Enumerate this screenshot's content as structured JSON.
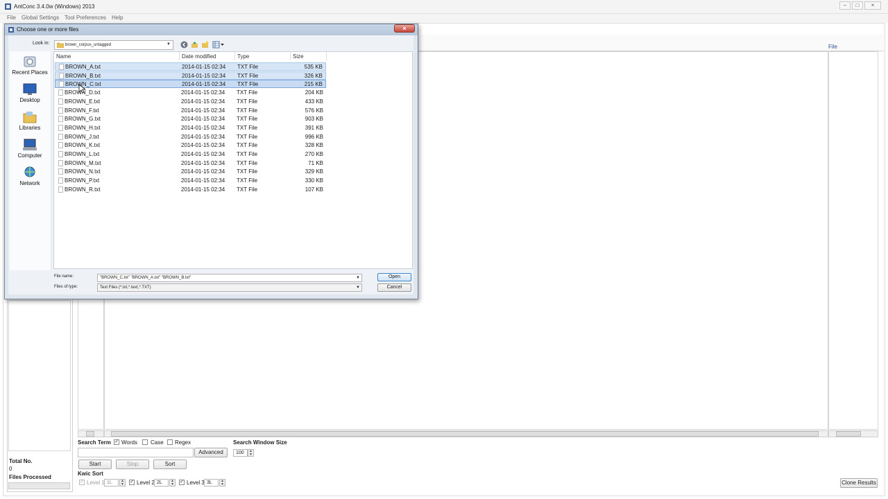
{
  "app": {
    "title": "AntConc 3.4.0w (Windows) 2013",
    "menu": [
      "File",
      "Global Settings",
      "Tool Preferences",
      "Help"
    ],
    "window_buttons": [
      "–",
      "□",
      "×"
    ]
  },
  "main": {
    "file_column_header": "File",
    "search": {
      "search_term_label": "Search Term",
      "words_label": "Words",
      "words_checked": true,
      "case_label": "Case",
      "case_checked": false,
      "regex_label": "Regex",
      "regex_checked": false,
      "advanced_label": "Advanced",
      "window_size_label": "Search Window Size",
      "window_size_value": "100"
    },
    "buttons": {
      "start": "Start",
      "stop": "Stop",
      "sort": "Sort"
    },
    "kwic": {
      "title": "Kwic Sort",
      "levels": [
        {
          "label": "Level 1",
          "value": "1L",
          "checked": false,
          "enabled": false
        },
        {
          "label": "Level 2",
          "value": "2L",
          "checked": true,
          "enabled": true
        },
        {
          "label": "Level 3",
          "value": "3L",
          "checked": true,
          "enabled": true
        }
      ]
    },
    "left_panel": {
      "total_label": "Total No.",
      "total_value": "0",
      "files_processed_label": "Files Processed"
    },
    "clone_results": "Clone Results"
  },
  "dialog": {
    "title": "Choose one or more files",
    "look_in_label": "Look in:",
    "look_in_value": "brown_corpus_untagged",
    "places": [
      "Recent Places",
      "Desktop",
      "Libraries",
      "Computer",
      "Network"
    ],
    "columns": [
      "Name",
      "Date modified",
      "Type",
      "Size"
    ],
    "files": [
      {
        "name": "BROWN_A.txt",
        "date": "2014-01-15 02:34",
        "type": "TXT File",
        "size": "535 KB",
        "selected": true
      },
      {
        "name": "BROWN_B.txt",
        "date": "2014-01-15 02:34",
        "type": "TXT File",
        "size": "326 KB",
        "selected": true
      },
      {
        "name": "BROWN_C.txt",
        "date": "2014-01-15 02:34",
        "type": "TXT File",
        "size": "215 KB",
        "selected": true,
        "focused": true
      },
      {
        "name": "BROWN_D.txt",
        "date": "2014-01-15 02:34",
        "type": "TXT File",
        "size": "204 KB"
      },
      {
        "name": "BROWN_E.txt",
        "date": "2014-01-15 02:34",
        "type": "TXT File",
        "size": "433 KB"
      },
      {
        "name": "BROWN_F.txt",
        "date": "2014-01-15 02:34",
        "type": "TXT File",
        "size": "576 KB"
      },
      {
        "name": "BROWN_G.txt",
        "date": "2014-01-15 02:34",
        "type": "TXT File",
        "size": "903 KB"
      },
      {
        "name": "BROWN_H.txt",
        "date": "2014-01-15 02:34",
        "type": "TXT File",
        "size": "391 KB"
      },
      {
        "name": "BROWN_J.txt",
        "date": "2014-01-15 02:34",
        "type": "TXT File",
        "size": "996 KB"
      },
      {
        "name": "BROWN_K.txt",
        "date": "2014-01-15 02:34",
        "type": "TXT File",
        "size": "328 KB"
      },
      {
        "name": "BROWN_L.txt",
        "date": "2014-01-15 02:34",
        "type": "TXT File",
        "size": "270 KB"
      },
      {
        "name": "BROWN_M.txt",
        "date": "2014-01-15 02:34",
        "type": "TXT File",
        "size": "71 KB"
      },
      {
        "name": "BROWN_N.txt",
        "date": "2014-01-15 02:34",
        "type": "TXT File",
        "size": "329 KB"
      },
      {
        "name": "BROWN_P.txt",
        "date": "2014-01-15 02:34",
        "type": "TXT File",
        "size": "330 KB"
      },
      {
        "name": "BROWN_R.txt",
        "date": "2014-01-15 02:34",
        "type": "TXT File",
        "size": "107 KB"
      }
    ],
    "file_name_label": "File name:",
    "file_name_value": "\"BROWN_C.txt\" \"BROWN_A.txt\" \"BROWN_B.txt\"",
    "files_of_type_label": "Files of type:",
    "files_of_type_value": "Text Files (*.txt,*.text,*.TXT)",
    "open_label": "Open",
    "cancel_label": "Cancel"
  }
}
